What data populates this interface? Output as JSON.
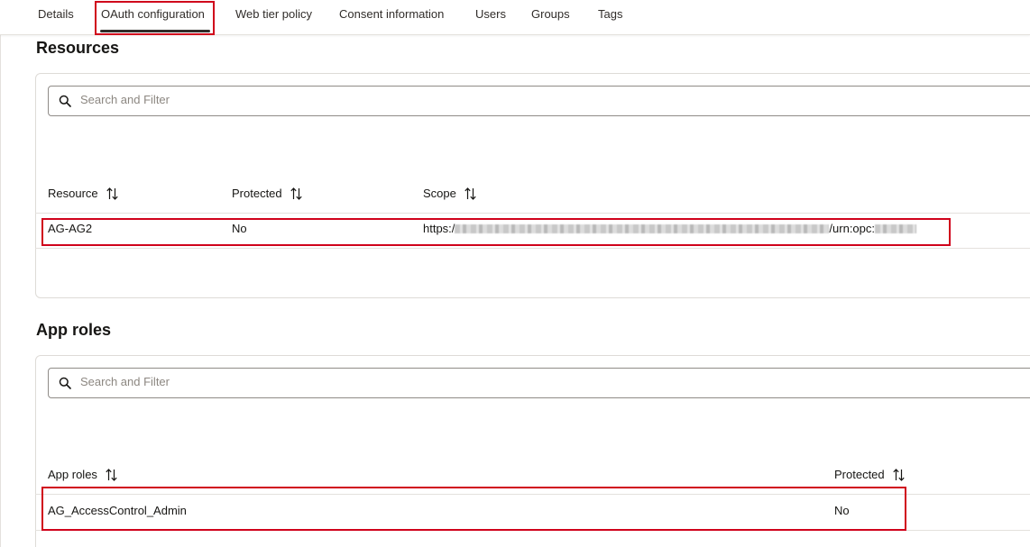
{
  "tabs": [
    {
      "label": "Details",
      "active": false
    },
    {
      "label": "OAuth configuration",
      "active": true
    },
    {
      "label": "Web tier policy",
      "active": false
    },
    {
      "label": "Consent information",
      "active": false
    },
    {
      "label": "Users",
      "active": false
    },
    {
      "label": "Groups",
      "active": false
    },
    {
      "label": "Tags",
      "active": false
    }
  ],
  "resources": {
    "title": "Resources",
    "search_placeholder": "Search and Filter",
    "columns": [
      "Resource",
      "Protected",
      "Scope"
    ],
    "rows": [
      {
        "resource": "AG-AG2",
        "protected": "No",
        "scope_prefix": "https:/",
        "scope_mid": "/urn:opc:"
      }
    ]
  },
  "app_roles": {
    "title": "App roles",
    "search_placeholder": "Search and Filter",
    "columns": [
      "App roles",
      "Protected"
    ],
    "rows": [
      {
        "app_role": "AG_AccessControl_Admin",
        "protected": "No"
      }
    ]
  },
  "colors": {
    "highlight": "#d0021b",
    "tab_underline": "#2f2c29",
    "border": "#dedbd7"
  }
}
